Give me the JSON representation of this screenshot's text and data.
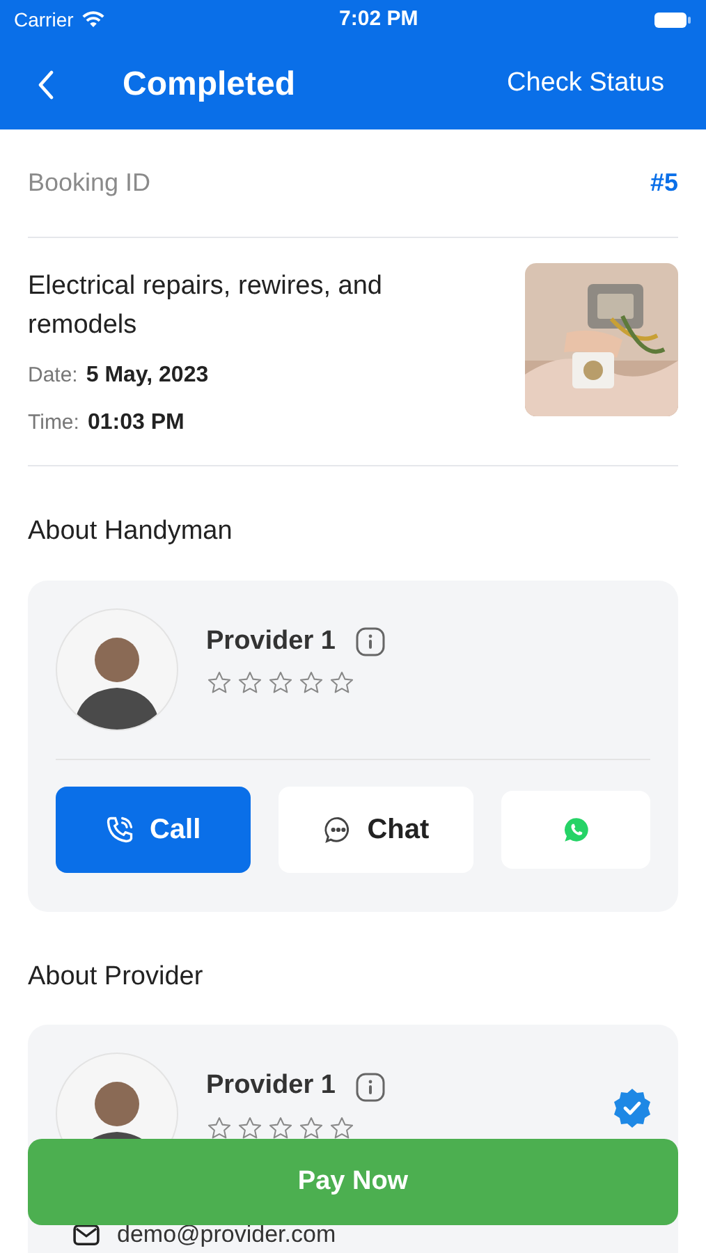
{
  "status_bar": {
    "carrier": "Carrier",
    "time": "7:02 PM"
  },
  "header": {
    "title": "Completed",
    "action": "Check Status"
  },
  "booking": {
    "label": "Booking ID",
    "value": "#5"
  },
  "service": {
    "name": "Electrical repairs, rewires, and remodels",
    "details": [
      {
        "label": "Date:",
        "value": "5 May, 2023"
      },
      {
        "label": "Time:",
        "value": "01:03 PM"
      }
    ]
  },
  "handyman": {
    "heading": "About Handyman",
    "name": "Provider 1",
    "stars": 0,
    "buttons": [
      {
        "kind": "call",
        "label": "Call"
      },
      {
        "kind": "chat",
        "label": "Chat"
      },
      {
        "kind": "whatsapp"
      }
    ]
  },
  "provider": {
    "heading": "About Provider",
    "name": "Provider 1",
    "stars": 0,
    "verified": true,
    "email": "demo@provider.com"
  },
  "pay_button": "Pay Now"
}
